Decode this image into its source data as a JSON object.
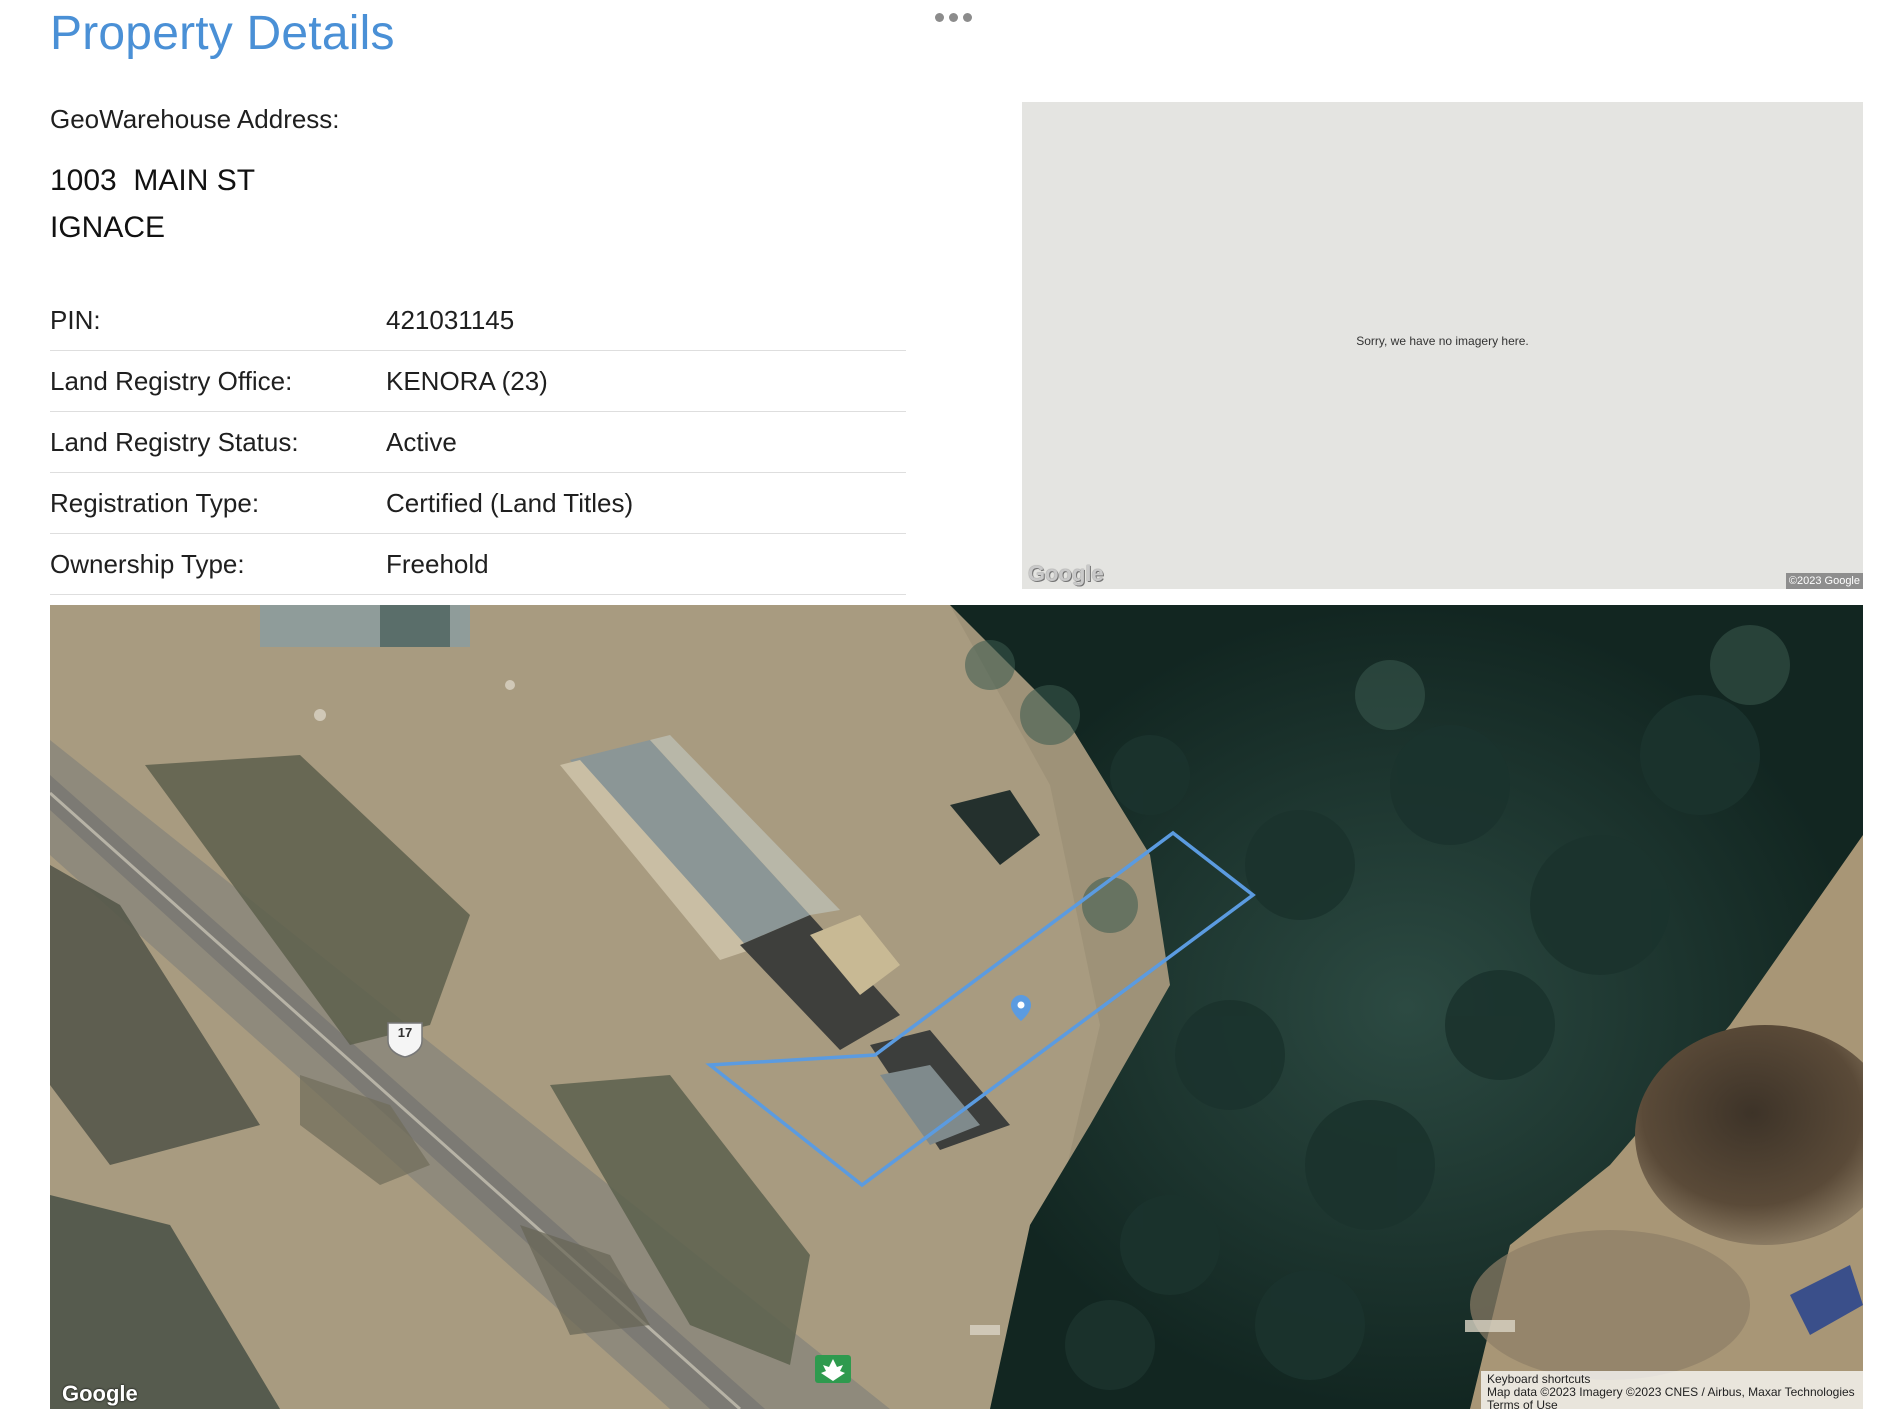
{
  "header": {
    "title": "Property Details"
  },
  "address": {
    "label": "GeoWarehouse Address:",
    "line1": "1003  MAIN ST",
    "line2": "IGNACE"
  },
  "details": [
    {
      "label": "PIN:",
      "value": "421031145"
    },
    {
      "label": "Land Registry Office:",
      "value": "KENORA (23)"
    },
    {
      "label": "Land Registry Status:",
      "value": "Active"
    },
    {
      "label": "Registration Type:",
      "value": "Certified (Land Titles)"
    },
    {
      "label": "Ownership Type:",
      "value": "Freehold"
    }
  ],
  "streetview": {
    "message": "Sorry, we have no imagery here.",
    "logo": "Google",
    "copyright": "©2023 Google"
  },
  "map": {
    "logo": "Google",
    "highway_shield": "17",
    "attribution": {
      "shortcuts": "Keyboard shortcuts",
      "data": "Map data ©2023 Imagery ©2023 CNES / Airbus, Maxar Technologies",
      "terms": "Terms of Use"
    },
    "parcel_color": "#5b9be0"
  }
}
